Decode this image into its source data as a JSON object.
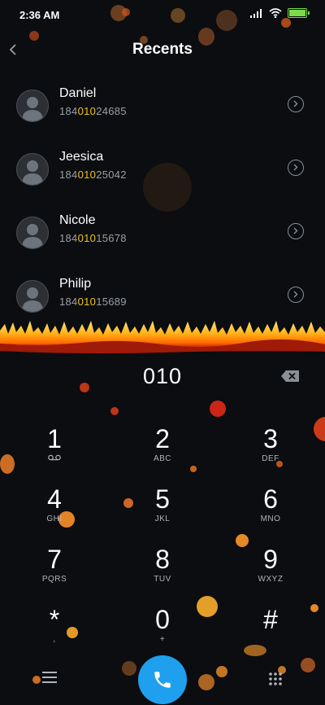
{
  "status": {
    "time": "2:36 AM"
  },
  "header": {
    "title": "Recents"
  },
  "contacts": [
    {
      "name": "Daniel",
      "num_pre": "184",
      "num_hl": "010",
      "num_post": "24685"
    },
    {
      "name": "Jeesica",
      "num_pre": "184",
      "num_hl": "010",
      "num_post": "25042"
    },
    {
      "name": "Nicole",
      "num_pre": "184",
      "num_hl": "010",
      "num_post": "15678"
    },
    {
      "name": "Philip",
      "num_pre": "184",
      "num_hl": "010",
      "num_post": "15689"
    }
  ],
  "dialer": {
    "input": "010",
    "keys": [
      {
        "digit": "1",
        "letters": ""
      },
      {
        "digit": "2",
        "letters": "ABC"
      },
      {
        "digit": "3",
        "letters": "DEF"
      },
      {
        "digit": "4",
        "letters": "GHI"
      },
      {
        "digit": "5",
        "letters": "JKL"
      },
      {
        "digit": "6",
        "letters": "MNO"
      },
      {
        "digit": "7",
        "letters": "PQRS"
      },
      {
        "digit": "8",
        "letters": "TUV"
      },
      {
        "digit": "9",
        "letters": "WXYZ"
      },
      {
        "digit": "*",
        "letters": ","
      },
      {
        "digit": "0",
        "letters": "+"
      },
      {
        "digit": "#",
        "letters": ""
      }
    ]
  },
  "colors": {
    "highlight": "#f0c020",
    "call_button": "#1fa0ee",
    "battery": "#7cd94a"
  },
  "icons": {
    "back": "chevron-left-icon",
    "info": "chevron-right-circle-icon",
    "backspace": "backspace-icon",
    "voicemail": "voicemail-icon",
    "menu": "hamburger-icon",
    "call": "phone-icon",
    "dialpad": "dialpad-icon"
  }
}
